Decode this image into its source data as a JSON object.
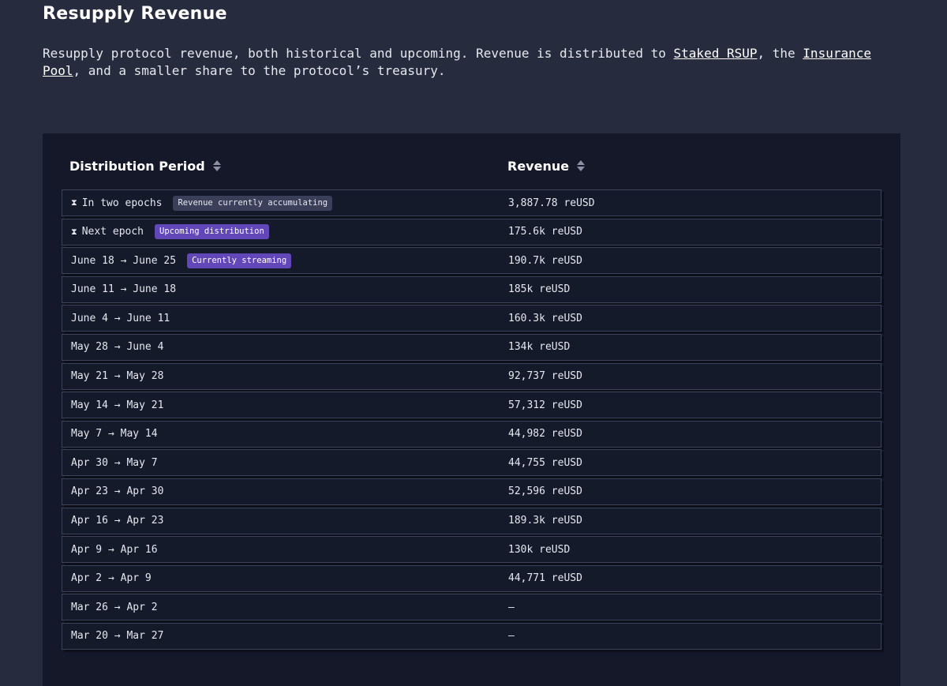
{
  "page": {
    "title": "Resupply Revenue",
    "description_part1": "Resupply protocol revenue, both historical and upcoming. Revenue is distributed to ",
    "link_staked": "Staked RSUP",
    "description_part2": ", the ",
    "link_insurance": "Insurance Pool",
    "description_part3": ", and a smaller share to the protocol’s treasury."
  },
  "table": {
    "col_period": "Distribution Period",
    "col_revenue": "Revenue",
    "rows": [
      {
        "icon": "⧗",
        "period": "In two epochs",
        "badge": "Revenue currently accumulating",
        "badge_style": "muted",
        "revenue": "3,887.78 reUSD"
      },
      {
        "icon": "⧗",
        "period": "Next epoch",
        "badge": "Upcoming distribution",
        "badge_style": "purple",
        "revenue": "175.6k reUSD"
      },
      {
        "icon": "",
        "period": "June 18 → June 25",
        "badge": "Currently streaming",
        "badge_style": "purple",
        "revenue": "190.7k reUSD"
      },
      {
        "icon": "",
        "period": "June 11 → June 18",
        "badge": "",
        "badge_style": "",
        "revenue": "185k reUSD"
      },
      {
        "icon": "",
        "period": "June 4 → June 11",
        "badge": "",
        "badge_style": "",
        "revenue": "160.3k reUSD"
      },
      {
        "icon": "",
        "period": "May 28 → June 4",
        "badge": "",
        "badge_style": "",
        "revenue": "134k reUSD"
      },
      {
        "icon": "",
        "period": "May 21 → May 28",
        "badge": "",
        "badge_style": "",
        "revenue": "92,737 reUSD"
      },
      {
        "icon": "",
        "period": "May 14 → May 21",
        "badge": "",
        "badge_style": "",
        "revenue": "57,312 reUSD"
      },
      {
        "icon": "",
        "period": "May 7 → May 14",
        "badge": "",
        "badge_style": "",
        "revenue": "44,982 reUSD"
      },
      {
        "icon": "",
        "period": "Apr 30 → May 7",
        "badge": "",
        "badge_style": "",
        "revenue": "44,755 reUSD"
      },
      {
        "icon": "",
        "period": "Apr 23 → Apr 30",
        "badge": "",
        "badge_style": "",
        "revenue": "52,596 reUSD"
      },
      {
        "icon": "",
        "period": "Apr 16 → Apr 23",
        "badge": "",
        "badge_style": "",
        "revenue": "189.3k reUSD"
      },
      {
        "icon": "",
        "period": "Apr 9 → Apr 16",
        "badge": "",
        "badge_style": "",
        "revenue": "130k reUSD"
      },
      {
        "icon": "",
        "period": "Apr 2 → Apr 9",
        "badge": "",
        "badge_style": "",
        "revenue": "44,771 reUSD"
      },
      {
        "icon": "",
        "period": "Mar 26 → Apr 2",
        "badge": "",
        "badge_style": "",
        "revenue": "–"
      },
      {
        "icon": "",
        "period": "Mar 20 → Mar 27",
        "badge": "",
        "badge_style": "",
        "revenue": "–"
      }
    ]
  },
  "colors": {
    "background": "#262b3d",
    "panel": "#141829",
    "badge_purple": "#6247b8",
    "badge_muted": "#3c3f5a"
  }
}
